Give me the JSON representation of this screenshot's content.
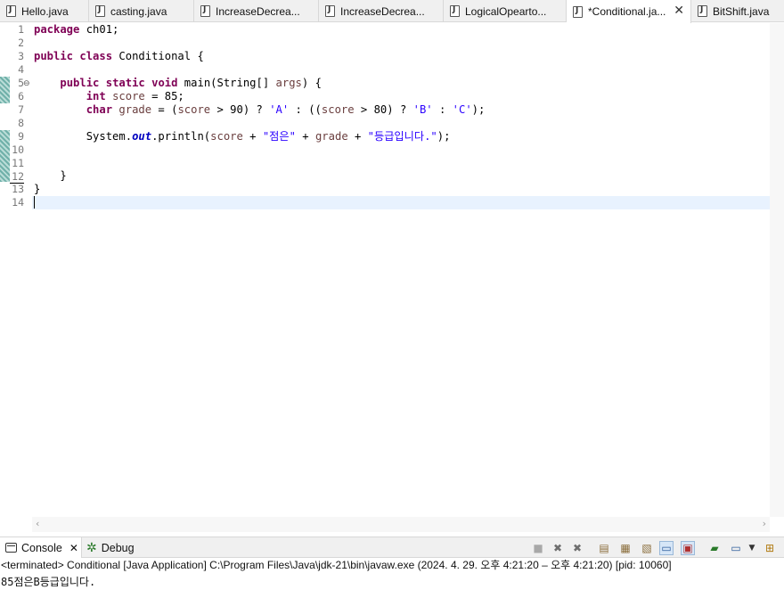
{
  "tabs": [
    {
      "label": "Hello.java"
    },
    {
      "label": "casting.java"
    },
    {
      "label": "IncreaseDecrea..."
    },
    {
      "label": "IncreaseDecrea..."
    },
    {
      "label": "LogicalOpearto..."
    },
    {
      "label": "*Conditional.ja...",
      "active": true
    },
    {
      "label": "BitShift.java"
    }
  ],
  "editor": {
    "line_numbers": [
      "1",
      "2",
      "3",
      "4",
      "5",
      "6",
      "7",
      "8",
      "9",
      "10",
      "11",
      "12",
      "13",
      "14"
    ],
    "fold_marker": "⊖",
    "code": {
      "l1_kw": "package",
      "l1_rest": " ch01;",
      "l3_kw1": "public",
      "l3_kw2": "class",
      "l3_rest": " Conditional {",
      "l5_kw1": "public",
      "l5_kw2": "static",
      "l5_kw3": "void",
      "l5_rest1": " main(String[] ",
      "l5_var": "args",
      "l5_rest2": ") {",
      "l6_kw": "int",
      "l6_var": "score",
      "l6_rest": " = 85;",
      "l7_kw": "char",
      "l7_var1": "grade",
      "l7_p1": " = (",
      "l7_var2": "score",
      "l7_p2": " > 90) ? ",
      "l7_s1": "'A'",
      "l7_p3": " : ((",
      "l7_var3": "score",
      "l7_p4": " > 80) ? ",
      "l7_s2": "'B'",
      "l7_p5": " : ",
      "l7_s3": "'C'",
      "l7_p6": ");",
      "l9_p1": "System.",
      "l9_static": "out",
      "l9_p2": ".println(",
      "l9_var1": "score",
      "l9_p3": " + ",
      "l9_s1": "\"점은\"",
      "l9_p4": " + ",
      "l9_var2": "grade",
      "l9_p5": " + ",
      "l9_s2": "\"등급입니다.\"",
      "l9_p6": ");",
      "l12": "}",
      "l13": "}"
    }
  },
  "console": {
    "tab_console": "Console",
    "tab_debug": "Debug",
    "status": "<terminated> Conditional [Java Application] C:\\Program Files\\Java\\jdk-21\\bin\\javaw.exe  (2024. 4. 29. 오후 4:21:20 – 오후 4:21:20) [pid: 10060]",
    "output": "85점은B등급입니다."
  },
  "colors": {
    "keyword": "#7f0055",
    "string": "#2a00ff",
    "variable": "#6a3e3e",
    "static_field": "#0000c0",
    "current_line": "#e8f2fe"
  },
  "icons": [
    "java-file-icon",
    "close-icon",
    "console-icon",
    "debug-bug-icon",
    "stop-icon",
    "remove-launch-icon",
    "remove-all-icon",
    "clear-console-icon",
    "scroll-lock-icon",
    "word-wrap-icon",
    "pin-console-icon",
    "show-console-icon",
    "display-selected-console-icon",
    "open-console-icon",
    "new-console-icon"
  ]
}
